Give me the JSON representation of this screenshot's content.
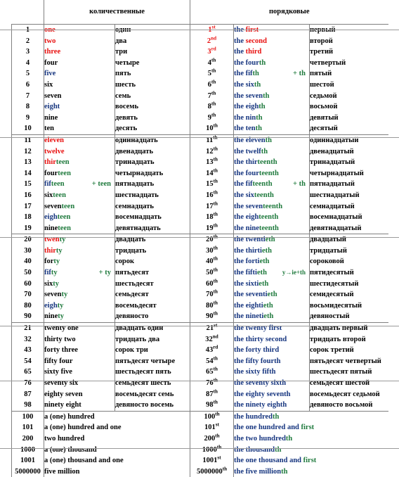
{
  "header": {
    "cardinal_label": "количественные",
    "ordinal_label": "порядковые"
  },
  "notes": {
    "teen": "+ teen",
    "ty": "+ ty",
    "th": "+ th",
    "th2": "+ th",
    "y_ie_th": "y→ie+th"
  },
  "colors": {
    "red": "#e8100f",
    "green": "#1f7a3d",
    "blue": "#16357f",
    "black": "#000000",
    "rule": "#808080"
  },
  "groups": [
    {
      "name": "units",
      "rows": [
        {
          "num": "1",
          "eng": "one",
          "rus": "один",
          "onum": "1",
          "osup": "st",
          "oeng": "the first",
          "orus": "первый"
        },
        {
          "num": "2",
          "eng": "two",
          "rus": "два",
          "onum": "2",
          "osup": "nd",
          "oeng": "the second",
          "orus": "второй"
        },
        {
          "num": "3",
          "eng": "three",
          "rus": "три",
          "onum": "3",
          "osup": "rd",
          "oeng": "the third",
          "orus": "третий"
        },
        {
          "num": "4",
          "eng": "four",
          "rus": "четыре",
          "onum": "4",
          "osup": "th",
          "oeng": "the fourth",
          "orus": "четвертый"
        },
        {
          "num": "5",
          "eng": "five",
          "rus": "пять",
          "onum": "5",
          "osup": "th",
          "oeng": "the fifth",
          "orus": "пятый"
        },
        {
          "num": "6",
          "eng": "six",
          "rus": "шесть",
          "onum": "6",
          "osup": "th",
          "oeng": "the sixth",
          "orus": "шестой"
        },
        {
          "num": "7",
          "eng": "seven",
          "rus": "семь",
          "onum": "7",
          "osup": "th",
          "oeng": "the seventh",
          "orus": "седьмой"
        },
        {
          "num": "8",
          "eng": "eight",
          "rus": "восемь",
          "onum": "8",
          "osup": "th",
          "oeng": "the eighth",
          "orus": "восьмой"
        },
        {
          "num": "9",
          "eng": "nine",
          "rus": "девять",
          "onum": "9",
          "osup": "th",
          "oeng": "the ninth",
          "orus": "девятый"
        },
        {
          "num": "10",
          "eng": "ten",
          "rus": "десять",
          "onum": "10",
          "osup": "th",
          "oeng": "the tenth",
          "orus": "десятый"
        }
      ]
    },
    {
      "name": "teens",
      "rows": [
        {
          "num": "11",
          "eng": "eleven",
          "rus": "одиннадцать",
          "onum": "11",
          "osup": "th",
          "oeng": "the eleventh",
          "orus": "одиннадцатый"
        },
        {
          "num": "12",
          "eng": "twelve",
          "rus": "двенадцать",
          "onum": "12",
          "osup": "th",
          "oeng": "the twelfth",
          "orus": "двенадцатый"
        },
        {
          "num": "13",
          "eng": "thirteen",
          "rus": "тринадцать",
          "onum": "13",
          "osup": "th",
          "oeng": "the thirteenth",
          "orus": "тринадцатый"
        },
        {
          "num": "14",
          "eng": "fourteen",
          "rus": "четырнадцать",
          "onum": "14",
          "osup": "th",
          "oeng": "the fourteenth",
          "orus": "четырнадцатый"
        },
        {
          "num": "15",
          "eng": "fifteen",
          "rus": "пятнадцать",
          "onum": "15",
          "osup": "th",
          "oeng": "the fifteenth",
          "orus": "пятнадцатый"
        },
        {
          "num": "16",
          "eng": "sixteen",
          "rus": "шестнадцать",
          "onum": "16",
          "osup": "th",
          "oeng": "the sixteenth",
          "orus": "шестнадцатый"
        },
        {
          "num": "17",
          "eng": "seventeen",
          "rus": "семнадцать",
          "onum": "17",
          "osup": "th",
          "oeng": "the seventeenth",
          "orus": "семнадцатый"
        },
        {
          "num": "18",
          "eng": "eighteen",
          "rus": "восемнадцать",
          "onum": "18",
          "osup": "th",
          "oeng": "the eighteenth",
          "orus": "восемнадцатый"
        },
        {
          "num": "19",
          "eng": "nineteen",
          "rus": "девятнадцать",
          "onum": "19",
          "osup": "th",
          "oeng": "the nineteenth",
          "orus": "девятнадцатый"
        }
      ]
    },
    {
      "name": "tens",
      "rows": [
        {
          "num": "20",
          "eng": "twenty",
          "rus": "двадцать",
          "onum": "20",
          "osup": "th",
          "oeng": "the twentieth",
          "orus": "двадцатый"
        },
        {
          "num": "30",
          "eng": "thirty",
          "rus": "тридцать",
          "onum": "30",
          "osup": "th",
          "oeng": "the thirtieth",
          "orus": "тридцатый"
        },
        {
          "num": "40",
          "eng": "forty",
          "rus": "сорок",
          "onum": "40",
          "osup": "th",
          "oeng": "the fortieth",
          "orus": "сороковой"
        },
        {
          "num": "50",
          "eng": "fifty",
          "rus": "пятьдесят",
          "onum": "50",
          "osup": "th",
          "oeng": "the fiftieth",
          "orus": "пятидесятый"
        },
        {
          "num": "60",
          "eng": "sixty",
          "rus": "шестьдесят",
          "onum": "60",
          "osup": "th",
          "oeng": "the sixtieth",
          "orus": "шестидесятый"
        },
        {
          "num": "70",
          "eng": "seventy",
          "rus": "семьдесят",
          "onum": "70",
          "osup": "th",
          "oeng": "the seventieth",
          "orus": "семидесятый"
        },
        {
          "num": "80",
          "eng": "eighty",
          "rus": "восемьдесят",
          "onum": "80",
          "osup": "th",
          "oeng": "the eightieth",
          "orus": "восьмидесятый"
        },
        {
          "num": "90",
          "eng": "ninety",
          "rus": "девяносто",
          "onum": "90",
          "osup": "th",
          "oeng": "the ninetieth",
          "orus": "девяностый"
        }
      ]
    },
    {
      "name": "compound",
      "rows": [
        {
          "num": "21",
          "eng": "twenty one",
          "rus": "двадцать один",
          "onum": "21",
          "osup": "st",
          "oeng": "the twenty first",
          "orus": "двадцать первый"
        },
        {
          "num": "32",
          "eng": "thirty two",
          "rus": "тридцать два",
          "onum": "32",
          "osup": "nd",
          "oeng": "the thirty second",
          "orus": "тридцать второй"
        },
        {
          "num": "43",
          "eng": "forty three",
          "rus": "сорок три",
          "onum": "43",
          "osup": "rd",
          "oeng": "the forty third",
          "orus": "сорок третий"
        },
        {
          "num": "54",
          "eng": "fifty four",
          "rus": "пятьдесят четыре",
          "onum": "54",
          "osup": "th",
          "oeng": "the fifty fourth",
          "orus": "пятьдесят четвертый"
        },
        {
          "num": "65",
          "eng": "sixty five",
          "rus": "шестьдесят пять",
          "onum": "65",
          "osup": "th",
          "oeng": "the sixty fifth",
          "orus": "шестьдесят пятый"
        },
        {
          "num": "76",
          "eng": "seventy six",
          "rus": "семьдесят шесть",
          "onum": "76",
          "osup": "th",
          "oeng": "the seventy sixth",
          "orus": "семьдесят шестой"
        },
        {
          "num": "87",
          "eng": "eighty seven",
          "rus": "восемьдесят семь",
          "onum": "87",
          "osup": "th",
          "oeng": "the eighty seventh",
          "orus": "восемьдесят седьмой"
        },
        {
          "num": "98",
          "eng": "ninety eight",
          "rus": "девяносто восемь",
          "onum": "98",
          "osup": "th",
          "oeng": "the ninety eighth",
          "orus": "девяносто восьмой"
        }
      ]
    },
    {
      "name": "large",
      "rows": [
        {
          "num": "100",
          "eng": "a (one) hundred",
          "onum": "100",
          "osup": "th",
          "oeng": "the hundredth"
        },
        {
          "num": "101",
          "eng": "a (one) hundred and one",
          "onum": "101",
          "osup": "st",
          "oeng": "the one hundred and first"
        },
        {
          "num": "200",
          "eng": "two hundred",
          "onum": "200",
          "osup": "th",
          "oeng": "the two hundredth"
        },
        {
          "num": "1000",
          "eng": "a (one) thousand",
          "onum": "1000",
          "osup": "th",
          "oeng": "the thousandth"
        },
        {
          "num": "1001",
          "eng": "a (one) thousand and one",
          "onum": "1001",
          "osup": "st",
          "oeng": "the one thousand and first"
        },
        {
          "num": "5000000",
          "eng": "five million",
          "onum": "5000000",
          "osup": "th",
          "oeng": "the five millionth"
        }
      ]
    }
  ]
}
